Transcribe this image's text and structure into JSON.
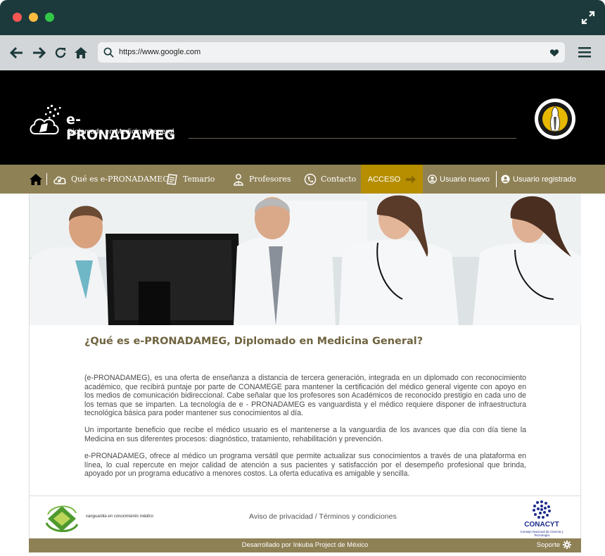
{
  "browser": {
    "url": "https://www.google.com"
  },
  "header": {
    "brand_title": "e-PRONADAMEG",
    "brand_subtitle": "Diplomado en Medicina General"
  },
  "nav": {
    "home_label": "",
    "items": [
      {
        "label": "Qué es e-PRONADAMEG"
      },
      {
        "label": "Temario"
      },
      {
        "label": "Profesores"
      },
      {
        "label": "Contacto"
      }
    ],
    "acceso_label": "ACCESO",
    "usuario_nuevo": "Usuario nuevo",
    "usuario_registrado": "Usuario registrado"
  },
  "content": {
    "title": "¿Qué es e-PRONADAMEG, Diplomado en Medicina General?",
    "paragraphs": [
      "(e-PRONADAMEG), es una oferta de enseñanza a distancia de tercera generación, integrada en un diplomado con reconocimiento académico, que recibirá puntaje por parte de CONAMEGE para mantener la certificación del médico general vigente con apoyo en los medios de comunicación bidireccional. Cabe señalar que los profesores son Académicos de reconocido prestigio en cada uno de los temas que se imparten. La tecnología de e - PRONADAMEG es vanguardista y el médico requiere disponer de infraestructura tecnológica básica para poder mantener sus conocimientos al día.",
      "Un importante beneficio que recibe el médico usuario es el mantenerse a la vanguardia de los avances que día con día tiene la Medicina en sus diferentes procesos: diagnóstico, tratamiento, rehabilitación y prevención.",
      "e-PRONADAMEG, ofrece al médico un programa versátil que permite actualizar sus conocimientos a través de una plataforma en línea, lo cual repercute en mejor calidad de atención a sus pacientes y satisfacción por el desempeño profesional que brinda, apoyado por un programa educativo a menores costos. La oferta educativa es amigable y sencilla."
    ]
  },
  "footer": {
    "tagline": "vanguardia en conocimiento médico",
    "legal": "Aviso de privacidad / Términos y condiciones",
    "conacyt_name": "CONACYT",
    "conacyt_sub": "Consejo Nacional de Ciencia y Tecnología",
    "credit": "Desarrollado por Inkuba Project de México",
    "support": "Soporte"
  }
}
